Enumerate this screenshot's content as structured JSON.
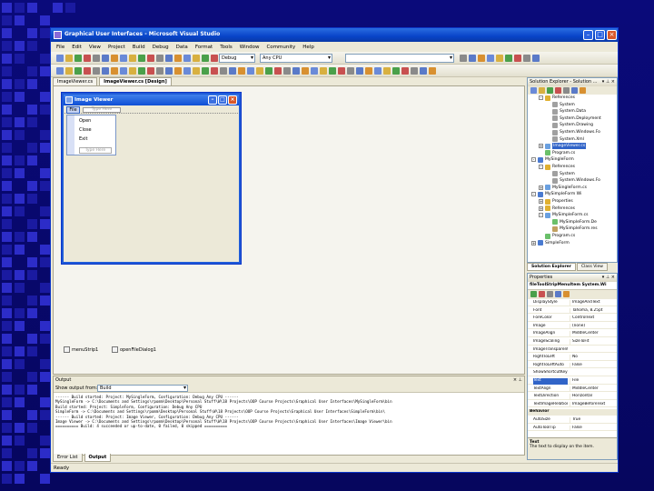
{
  "colors": {
    "slide_bg": "#0a0a7a",
    "accent_squares": "#2c2cc8",
    "titlebar": "#0844c8",
    "selection": "#3164c8"
  },
  "window": {
    "title": "Graphical User Interfaces - Microsoft Visual Studio"
  },
  "menubar": [
    "File",
    "Edit",
    "View",
    "Project",
    "Build",
    "Debug",
    "Data",
    "Format",
    "Tools",
    "Window",
    "Community",
    "Help"
  ],
  "toolbar": {
    "config": "Debug",
    "platform": "Any CPU"
  },
  "editor_tabs": [
    "ImageViewer.cs",
    "ImageViewer.cs [Design]"
  ],
  "form": {
    "title": "Image Viewer",
    "menu_file": "File",
    "menu_type_here": "Type Here",
    "dropdown": [
      "Open",
      "Close",
      "Exit"
    ],
    "dropdown_type_here": "Type Here"
  },
  "tray": [
    "menuStrip1",
    "openFileDialog1"
  ],
  "output": {
    "title": "Output",
    "show_from_label": "Show output from:",
    "show_from_value": "Build",
    "lines": [
      "------ Build started: Project: MySingleForm, Configuration: Debug Any CPU ------",
      "MySingleForm -> C:\\Documents and Settings\\rpomm\\Desktop\\Personal Stuff\\W\\18 Projects\\OOP Course Projects\\Graphical User Interfaces\\MySingleForm\\bin",
      "       Build started: Project: SimpleForm, Configuration: Debug Any CPU",
      "SimpleForm -> C:\\Documents and Settings\\rpomm\\Desktop\\Personal Stuff\\W\\18 Projects\\OOP Course Projects\\Graphical User Interfaces\\SimpleForm\\bin\\",
      "------ Build started: Project: Image Viewer, Configuration: Debug Any CPU ------",
      "Image Viewer -> C:\\Documents and Settings\\rpomm\\Desktop\\Personal Stuff\\W\\18 Projects\\OOP Course Projects\\Graphical User Interfaces\\Image Viewer\\bin",
      "========== Build: 4 succeeded or up-to-date, 0 failed, 0 skipped =========="
    ],
    "tabs": [
      "Error List",
      "Output"
    ]
  },
  "status": "Ready",
  "solution_explorer": {
    "title": "Solution Explorer - Solution ...",
    "tabs": [
      "Solution Explorer",
      "Class View"
    ],
    "items": [
      {
        "label": "References",
        "expander": "-",
        "icon": "#e0b030"
      },
      {
        "label": "System",
        "expander": "",
        "icon": "#a0a0a0"
      },
      {
        "label": "System.Data",
        "expander": "",
        "icon": "#a0a0a0"
      },
      {
        "label": "System.Deployment",
        "expander": "",
        "icon": "#a0a0a0"
      },
      {
        "label": "System.Drawing",
        "expander": "",
        "icon": "#a0a0a0"
      },
      {
        "label": "System.Windows.Fo",
        "expander": "",
        "icon": "#a0a0a0"
      },
      {
        "label": "System.Xml",
        "expander": "",
        "icon": "#a0a0a0"
      },
      {
        "label": "ImageViewer.cs",
        "expander": "+",
        "icon": "#6aa0e0",
        "selected": true
      },
      {
        "label": "Program.cs",
        "expander": "",
        "icon": "#6ac06a"
      },
      {
        "label": "MySingleForm",
        "expander": "-",
        "icon": "#4a7ad0"
      },
      {
        "label": "References",
        "expander": "-",
        "icon": "#e0b030"
      },
      {
        "label": "System",
        "expander": "",
        "icon": "#a0a0a0"
      },
      {
        "label": "System.Windows.Fo",
        "expander": "",
        "icon": "#a0a0a0"
      },
      {
        "label": "MySingleForm.cs",
        "expander": "+",
        "icon": "#6aa0e0"
      },
      {
        "label": "MySimpleForm Wi",
        "expander": "-",
        "icon": "#4a7ad0"
      },
      {
        "label": "Properties",
        "expander": "+",
        "icon": "#e0b030"
      },
      {
        "label": "References",
        "expander": "+",
        "icon": "#e0b030"
      },
      {
        "label": "MySimpleForm.cs",
        "expander": "-",
        "icon": "#6aa0e0"
      },
      {
        "label": "MySimpleForm.De",
        "expander": "",
        "icon": "#6ac06a"
      },
      {
        "label": "MySimpleForm.res",
        "expander": "",
        "icon": "#c0a060"
      },
      {
        "label": "Program.cs",
        "expander": "",
        "icon": "#6ac06a"
      },
      {
        "label": "SimpleForm",
        "expander": "+",
        "icon": "#4a7ad0"
      }
    ]
  },
  "properties": {
    "title": "Properties",
    "selected_object": "fileToolStripMenuItem System.Wi",
    "rows": [
      {
        "name": "DisplayStyle",
        "value": "ImageAndText"
      },
      {
        "name": "Font",
        "value": "Tahoma, 8.25pt",
        "cat": false
      },
      {
        "name": "ForeColor",
        "value": "ControlText"
      },
      {
        "name": "Image",
        "value": "(none)"
      },
      {
        "name": "ImageAlign",
        "value": "MiddleCenter"
      },
      {
        "name": "ImageScaling",
        "value": "SizeToFit"
      },
      {
        "name": "ImageTransparent",
        "value": ""
      },
      {
        "name": "RightToLeft",
        "value": "No"
      },
      {
        "name": "RightToLeftAuto",
        "value": "False"
      },
      {
        "name": "ShowShortcutKey",
        "value": ""
      },
      {
        "name": "Text",
        "value": "File",
        "selected": true
      },
      {
        "name": "TextAlign",
        "value": "MiddleCenter"
      },
      {
        "name": "TextDirection",
        "value": "Horizontal"
      },
      {
        "name": "TextImageRelation",
        "value": "ImageBeforeText"
      },
      {
        "name": "Behavior",
        "value": "",
        "cat": true
      },
      {
        "name": "AutoSize",
        "value": "True"
      },
      {
        "name": "AutoToolTip",
        "value": "False"
      }
    ],
    "desc_title": "Text",
    "desc_text": "The text to display on the item."
  }
}
